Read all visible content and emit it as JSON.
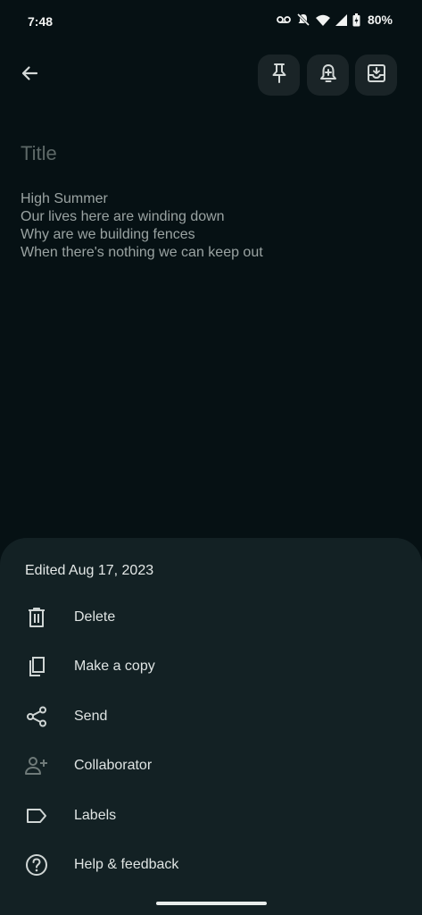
{
  "status_bar": {
    "time": "7:48",
    "battery_percent": "80%",
    "icons": [
      "voicemail-icon",
      "mute-icon",
      "wifi-icon",
      "signal-icon",
      "battery-icon"
    ]
  },
  "toolbar": {
    "icons": [
      "back-arrow-icon",
      "pin-icon",
      "add-reminder-icon",
      "archive-icon"
    ]
  },
  "note": {
    "title_placeholder": "Title",
    "body_lines": [
      "High Summer",
      "Our lives here are winding down",
      "Why are we building fences",
      "When there's nothing we can keep out"
    ]
  },
  "sheet": {
    "edited": "Edited Aug 17, 2023",
    "items": [
      {
        "label": "Delete",
        "icon": "trash-icon"
      },
      {
        "label": "Make a copy",
        "icon": "copy-icon"
      },
      {
        "label": "Send",
        "icon": "share-icon"
      },
      {
        "label": "Collaborator",
        "icon": "add-person-icon"
      },
      {
        "label": "Labels",
        "icon": "label-icon"
      },
      {
        "label": "Help & feedback",
        "icon": "help-icon"
      }
    ]
  },
  "colors": {
    "background": "#061114",
    "sheet_background": "#132124",
    "button_background": "#1a2427",
    "text_primary": "#e3e7e6",
    "text_muted": "#9aa3a2",
    "placeholder": "#5d6867"
  }
}
